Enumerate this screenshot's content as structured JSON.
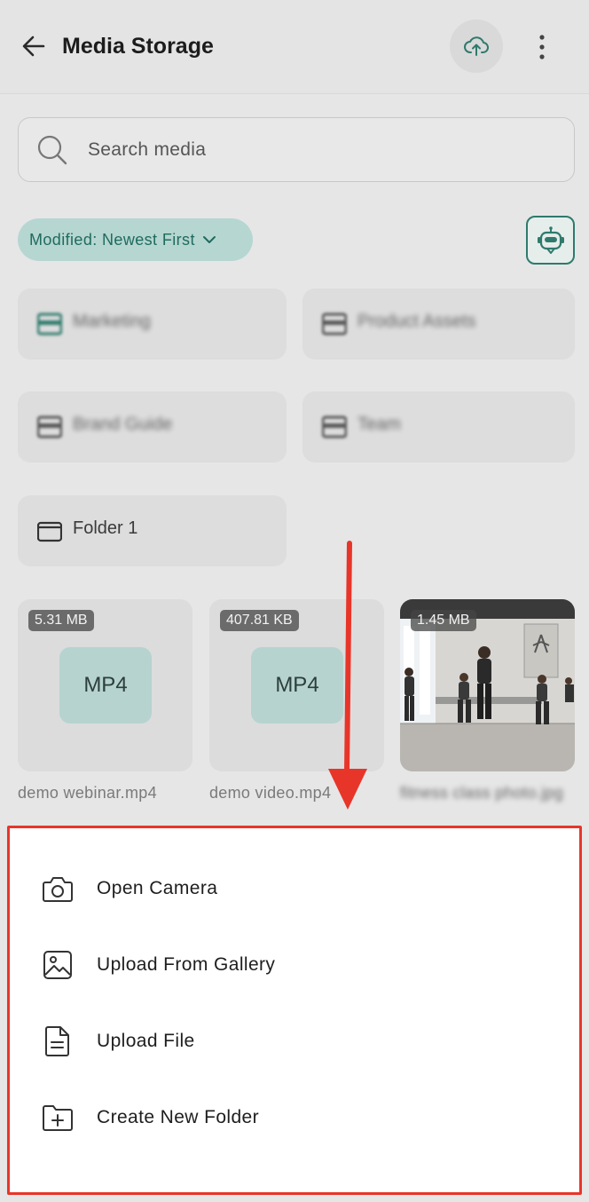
{
  "header": {
    "title": "Media Storage"
  },
  "search": {
    "placeholder": "Search media"
  },
  "sort": {
    "label": "Modified: Newest First"
  },
  "folders": [
    {
      "name": "Marketing"
    },
    {
      "name": "Product Assets"
    },
    {
      "name": "Brand Guide"
    },
    {
      "name": "Team"
    },
    {
      "name": "Folder 1"
    }
  ],
  "media": [
    {
      "size": "5.31 MB",
      "type": "MP4",
      "name": "demo webinar.mp4"
    },
    {
      "size": "407.81 KB",
      "type": "MP4",
      "name": "demo video.mp4"
    },
    {
      "size": "1.45 MB",
      "type": "image",
      "name": "fitness class photo.jpg"
    }
  ],
  "sheet": {
    "items": [
      {
        "label": "Open Camera",
        "icon": "camera-icon"
      },
      {
        "label": "Upload From Gallery",
        "icon": "image-icon"
      },
      {
        "label": "Upload File",
        "icon": "file-icon"
      },
      {
        "label": "Create New Folder",
        "icon": "folder-plus-icon"
      }
    ]
  },
  "colors": {
    "accent": "#2f7a6c",
    "chip_bg": "#b6d6d1",
    "highlight": "#e8352a"
  }
}
